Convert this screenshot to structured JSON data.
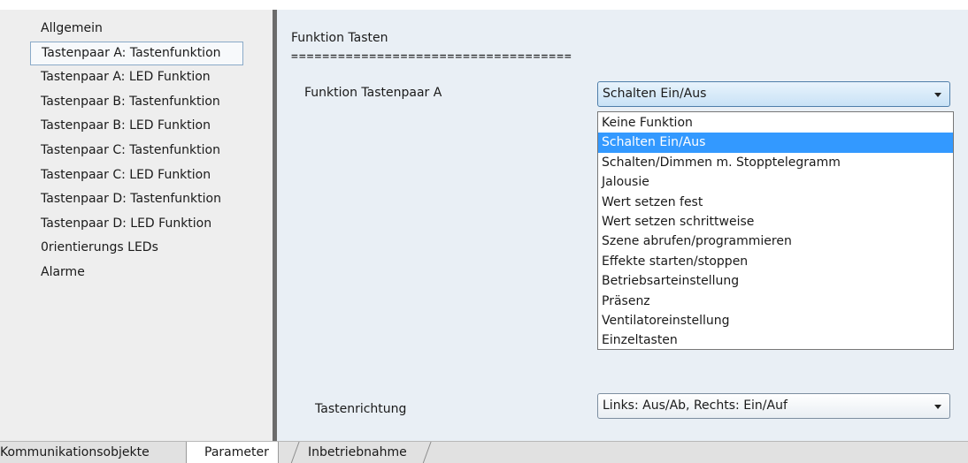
{
  "sidebar": {
    "items": [
      {
        "label": "Allgemein"
      },
      {
        "label": "Tastenpaar A: Tastenfunktion"
      },
      {
        "label": "Tastenpaar A: LED Funktion"
      },
      {
        "label": "Tastenpaar B: Tastenfunktion"
      },
      {
        "label": "Tastenpaar B: LED Funktion"
      },
      {
        "label": "Tastenpaar C: Tastenfunktion"
      },
      {
        "label": "Tastenpaar C: LED Funktion"
      },
      {
        "label": "Tastenpaar D: Tastenfunktion"
      },
      {
        "label": "Tastenpaar D: LED Funktion"
      },
      {
        "label": "0rientierungs LEDs"
      },
      {
        "label": "Alarme"
      }
    ],
    "selected_index": 1
  },
  "main": {
    "section_title": "Funktion Tasten",
    "separator": "====================================",
    "param1": {
      "label": "Funktion Tastenpaar A",
      "value": "Schalten Ein/Aus",
      "options": [
        "Keine Funktion",
        "Schalten Ein/Aus",
        "Schalten/Dimmen m. Stopptelegramm",
        "Jalousie",
        "Wert setzen fest",
        "Wert setzen schrittweise",
        "Szene abrufen/programmieren",
        "Effekte starten/stoppen",
        "Betriebsarteinstellung",
        "Präsenz",
        "Ventilatoreinstellung",
        "Einzeltasten"
      ],
      "selected_option_index": 1
    },
    "param2": {
      "label": "Tastenrichtung",
      "value": "Links: Aus/Ab, Rechts: Ein/Auf"
    }
  },
  "tabs": [
    {
      "label": "Kommunikationsobjekte"
    },
    {
      "label": "Parameter"
    },
    {
      "label": "Inbetriebnahme"
    }
  ],
  "active_tab_index": 1,
  "colors": {
    "selection": "#3399ff",
    "sidebar_bg": "#eeeeee",
    "content_bg": "#e9eff5"
  }
}
